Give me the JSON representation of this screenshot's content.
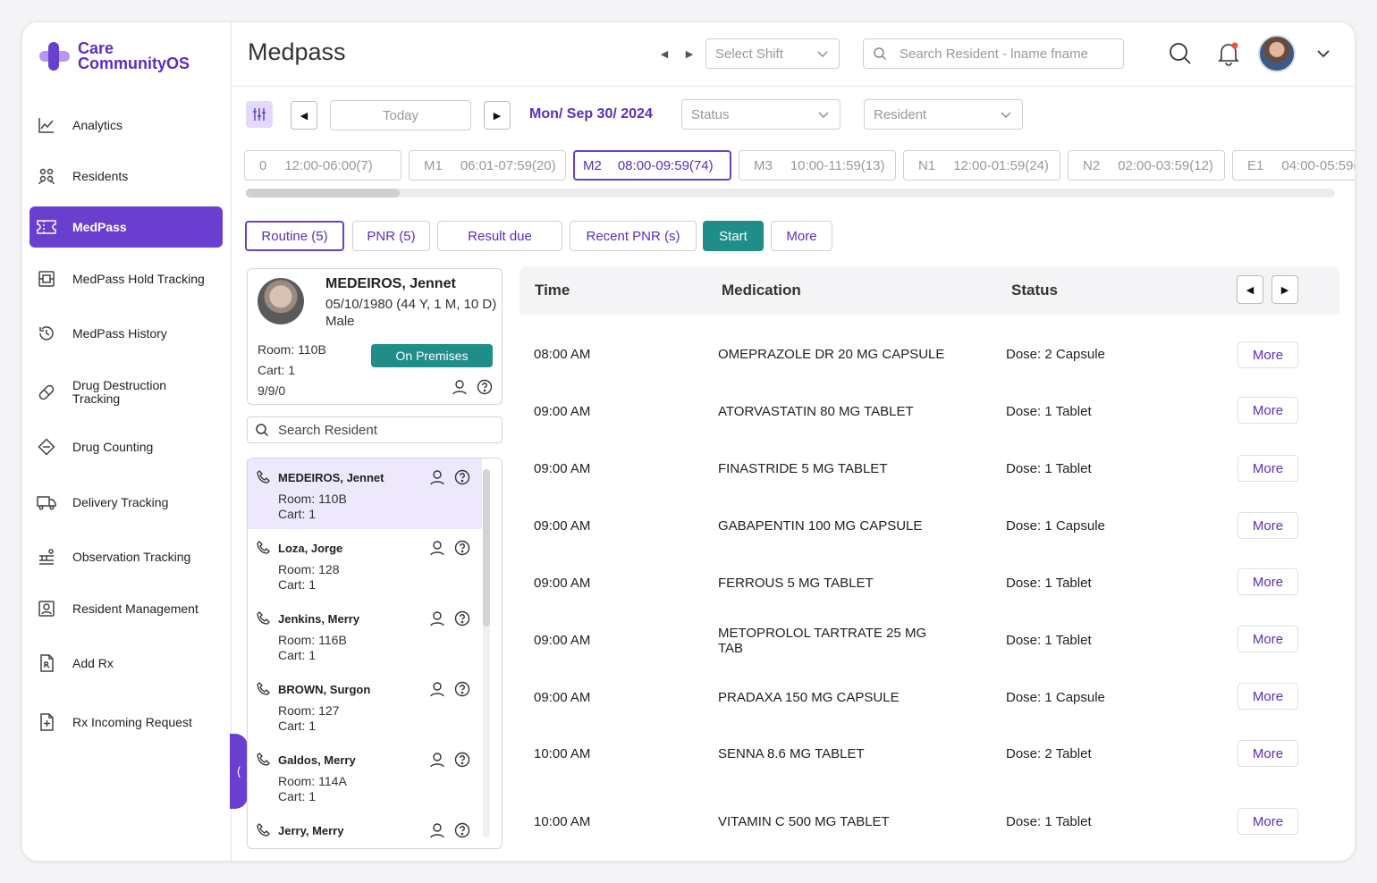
{
  "app": {
    "logo": {
      "line1": "Care",
      "line2": "CommunityOS"
    },
    "page_title": "Medpass"
  },
  "sidebar": {
    "items": [
      {
        "label": "Analytics",
        "icon": "chart-line-icon"
      },
      {
        "label": "Residents",
        "icon": "users-icon"
      },
      {
        "label": "MedPass",
        "icon": "ticket-icon",
        "active": true
      },
      {
        "label": "MedPass Hold Tracking",
        "icon": "pill-box-icon"
      },
      {
        "label": "MedPass History",
        "icon": "history-icon"
      },
      {
        "label": "Drug Destruction Tracking",
        "icon": "capsule-icon"
      },
      {
        "label": "Drug Counting",
        "icon": "tablet-icon"
      },
      {
        "label": "Delivery Tracking",
        "icon": "truck-icon"
      },
      {
        "label": "Observation Tracking",
        "icon": "observation-icon"
      },
      {
        "label": "Resident Management",
        "icon": "id-card-icon"
      },
      {
        "label": "Add Rx",
        "icon": "rx-document-icon"
      },
      {
        "label": "Rx Incoming Request",
        "icon": "document-plus-icon"
      }
    ]
  },
  "header": {
    "shift_placeholder": "Select Shift",
    "search_placeholder": "Search Resident - lname fname"
  },
  "toolbar": {
    "today_label": "Today",
    "date_label": "Mon/ Sep 30/ 2024",
    "status_placeholder": "Status",
    "resident_placeholder": "Resident"
  },
  "shifts": [
    {
      "code": "0",
      "range": "12:00-06:00(7)"
    },
    {
      "code": "M1",
      "range": "06:01-07:59(20)"
    },
    {
      "code": "M2",
      "range": "08:00-09:59(74)",
      "active": true
    },
    {
      "code": "M3",
      "range": "10:00-11:59(13)"
    },
    {
      "code": "N1",
      "range": "12:00-01:59(24)"
    },
    {
      "code": "N2",
      "range": "02:00-03:59(12)"
    },
    {
      "code": "E1",
      "range": "04:00-05:59("
    }
  ],
  "actions": {
    "routine": "Routine (5)",
    "pnr": "PNR (5)",
    "result_due": "Result due",
    "recent_pnr": "Recent PNR (s)",
    "start": "Start",
    "more": "More"
  },
  "resident_card": {
    "name": "MEDEIROS, Jennet",
    "dob": "05/10/1980 (44 Y, 1 M, 10 D)",
    "sex": "Male",
    "room": "Room: 110B",
    "cart": "Cart: 1",
    "code": "9/9/0",
    "status": "On Premises"
  },
  "resident_search_placeholder": "Search Resident",
  "resident_list": [
    {
      "name": "MEDEIROS, Jennet",
      "room": "Room: 110B",
      "cart": "Cart: 1",
      "selected": true
    },
    {
      "name": "Loza, Jorge",
      "room": "Room: 128",
      "cart": "Cart: 1"
    },
    {
      "name": "Jenkins, Merry",
      "room": "Room: 116B",
      "cart": "Cart: 1"
    },
    {
      "name": "BROWN, Surgon",
      "room": "Room: 127",
      "cart": "Cart: 1"
    },
    {
      "name": "Galdos, Merry",
      "room": "Room: 114A",
      "cart": "Cart: 1"
    },
    {
      "name": "Jerry, Merry",
      "room": "",
      "cart": ""
    }
  ],
  "table": {
    "headers": {
      "time": "Time",
      "medication": "Medication",
      "status": "Status"
    },
    "rows": [
      {
        "time": "08:00 AM",
        "medication": "OMEPRAZOLE DR 20 MG CAPSULE",
        "dose": "Dose: 2 Capsule",
        "action": "More"
      },
      {
        "time": "09:00 AM",
        "medication": "ATORVASTATIN 80 MG TABLET",
        "dose": "Dose: 1 Tablet",
        "action": "More"
      },
      {
        "time": "09:00 AM",
        "medication": "FINASTRIDE 5 MG TABLET",
        "dose": "Dose: 1 Tablet",
        "action": "More"
      },
      {
        "time": "09:00 AM",
        "medication": "GABAPENTIN 100 MG CAPSULE",
        "dose": "Dose: 1 Capsule",
        "action": "More"
      },
      {
        "time": "09:00 AM",
        "medication": "FERROUS 5 MG TABLET",
        "dose": "Dose: 1 Tablet",
        "action": "More"
      },
      {
        "time": "09:00 AM",
        "medication": "METOPROLOL TARTRATE 25 MG TAB",
        "dose": "Dose: 1 Tablet",
        "action": "More"
      },
      {
        "time": "09:00 AM",
        "medication": "PRADAXA 150 MG CAPSULE",
        "dose": "Dose: 1 Capsule",
        "action": "More"
      },
      {
        "time": "10:00 AM",
        "medication": "SENNA 8.6 MG TABLET",
        "dose": "Dose: 2 Tablet",
        "action": "More"
      },
      {
        "time": "10:00 AM",
        "medication": "VITAMIN C 500 MG TABLET",
        "dose": "Dose: 1 Tablet",
        "action": "More"
      }
    ]
  },
  "colors": {
    "brand": "#6a3fd0",
    "teal": "#1f8d88"
  }
}
